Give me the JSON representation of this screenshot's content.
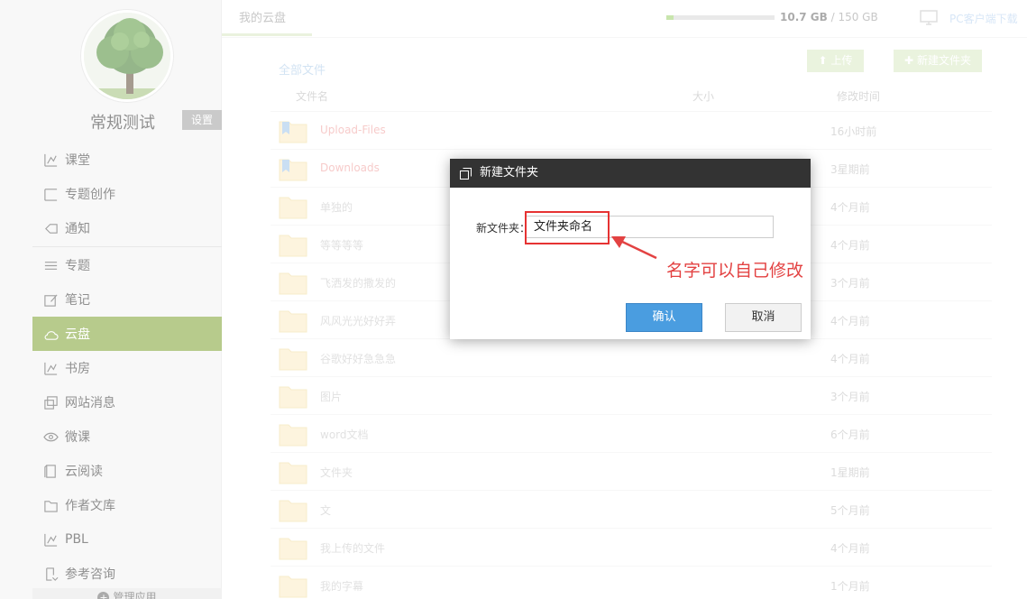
{
  "user": {
    "name": "常规测试",
    "settings_label": "设置"
  },
  "sidebar": {
    "items": [
      {
        "label": "课堂",
        "icon": "classroom-icon",
        "active": false
      },
      {
        "label": "专题创作",
        "icon": "topic-create-icon",
        "active": false
      },
      {
        "label": "通知",
        "icon": "notification-icon",
        "active": false
      },
      {
        "label": "专题",
        "icon": "topic-icon",
        "active": false
      },
      {
        "label": "笔记",
        "icon": "note-icon",
        "active": false
      },
      {
        "label": "云盘",
        "icon": "cloud-icon",
        "active": true
      },
      {
        "label": "书房",
        "icon": "study-icon",
        "active": false
      },
      {
        "label": "网站消息",
        "icon": "message-icon",
        "active": false
      },
      {
        "label": "微课",
        "icon": "eye-icon",
        "active": false
      },
      {
        "label": "云阅读",
        "icon": "reader-icon",
        "active": false
      },
      {
        "label": "作者文库",
        "icon": "folder-icon",
        "active": false
      },
      {
        "label": "PBL",
        "icon": "pbl-icon",
        "active": false
      },
      {
        "label": "参考咨询",
        "icon": "consult-icon",
        "active": false
      }
    ],
    "manage_label": "管理应用"
  },
  "topbar": {
    "tab": "我的云盘",
    "storage_used": "10.7 GB",
    "storage_total": "/ 150 GB",
    "storage_fraction": 0.07,
    "client_link": "PC客户端下载"
  },
  "main": {
    "breadcrumb": "全部文件",
    "upload_label": "上传",
    "new_folder_label": "新建文件夹",
    "columns": {
      "name": "文件名",
      "size": "大小",
      "modified": "修改时间"
    },
    "files": [
      {
        "name": "Upload-Files",
        "time": "16小时前",
        "type": "bookmark"
      },
      {
        "name": "Downloads",
        "time": "3星期前",
        "type": "bookmark"
      },
      {
        "name": "单独的",
        "time": "4个月前",
        "type": "folder"
      },
      {
        "name": "等等等等",
        "time": "4个月前",
        "type": "folder"
      },
      {
        "name": "飞洒发的撒发的",
        "time": "3个月前",
        "type": "folder"
      },
      {
        "name": "风风光光好好弄",
        "time": "4个月前",
        "type": "folder"
      },
      {
        "name": "谷歌好好急急急",
        "time": "4个月前",
        "type": "folder"
      },
      {
        "name": "图片",
        "time": "3个月前",
        "type": "folder"
      },
      {
        "name": "word文档",
        "time": "6个月前",
        "type": "folder"
      },
      {
        "name": "文件夹",
        "time": "1星期前",
        "type": "folder"
      },
      {
        "name": "文",
        "time": "5个月前",
        "type": "folder"
      },
      {
        "name": "我上传的文件",
        "time": "4个月前",
        "type": "folder"
      },
      {
        "name": "我的字幕",
        "time": "1个月前",
        "type": "folder"
      }
    ]
  },
  "dialog": {
    "title": "新建文件夹",
    "field_label": "新文件夹：",
    "value": "文件夹命名",
    "ok_label": "确认",
    "cancel_label": "取消"
  },
  "annotation": {
    "text": "名字可以自己修改",
    "color": "#e34242"
  },
  "colors": {
    "accent": "#7ca12f",
    "primary_button": "#4a9de0",
    "dialog_header": "#333333"
  }
}
